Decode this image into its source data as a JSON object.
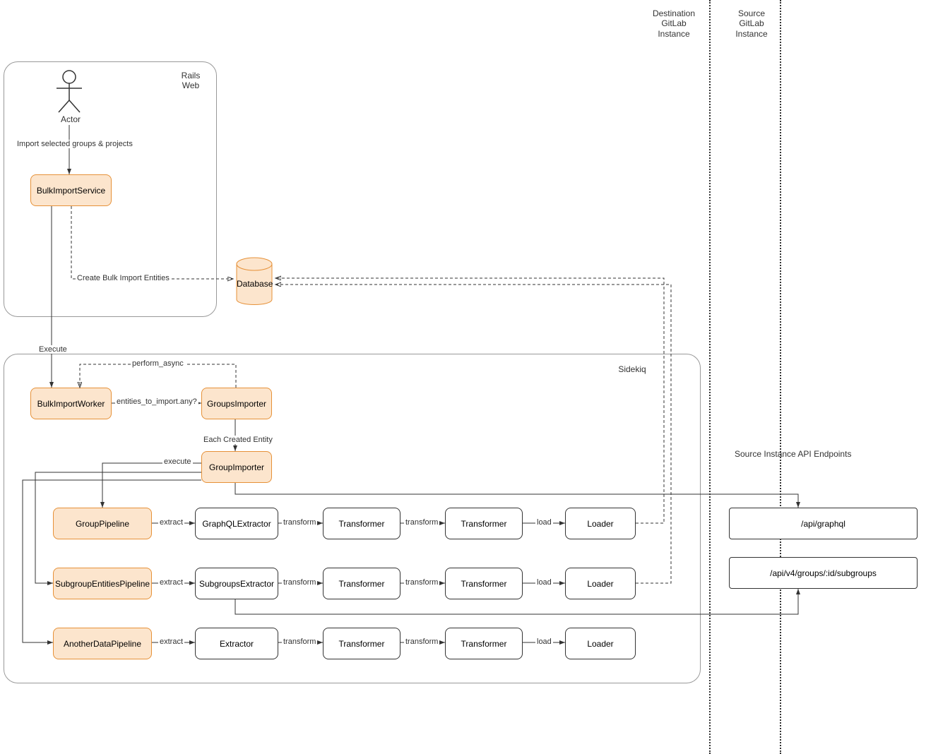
{
  "labels": {
    "dest_instance": "Destination\nGitLab\nInstance",
    "src_instance": "Source\nGitLab\nInstance",
    "source_endpoints_title": "Source Instance API Endpoints"
  },
  "regions": {
    "rails_web": "Rails\nWeb",
    "sidekiq": "Sidekiq"
  },
  "actor": {
    "label": "Actor"
  },
  "nodes": {
    "bulk_import_service": "BulkImportService",
    "bulk_import_worker": "BulkImportWorker",
    "groups_importer": "GroupsImporter",
    "group_importer": "GroupImporter",
    "group_pipeline": "GroupPipeline",
    "subgroup_entities_pipeline": "SubgroupEntitiesPipeline",
    "another_data_pipeline": "AnotherDataPipeline",
    "graphql_extractor": "GraphQLExtractor",
    "subgroups_extractor": "SubgroupsExtractor",
    "extractor": "Extractor",
    "transformer": "Transformer",
    "loader": "Loader",
    "database": "Database",
    "api_graphql": "/api/graphql",
    "api_subgroups": "/api/v4/groups/:id/subgroups"
  },
  "edges": {
    "import_selected": "Import selected groups & projects",
    "create_entities": "Create Bulk Import Entities",
    "execute": "Execute",
    "perform_async": "perform_async",
    "entities_any": "entities_to_import.any?",
    "each_entity": "Each Created Entity",
    "execute_lower": "execute",
    "extract": "extract",
    "transform": "transform",
    "load": "load"
  }
}
